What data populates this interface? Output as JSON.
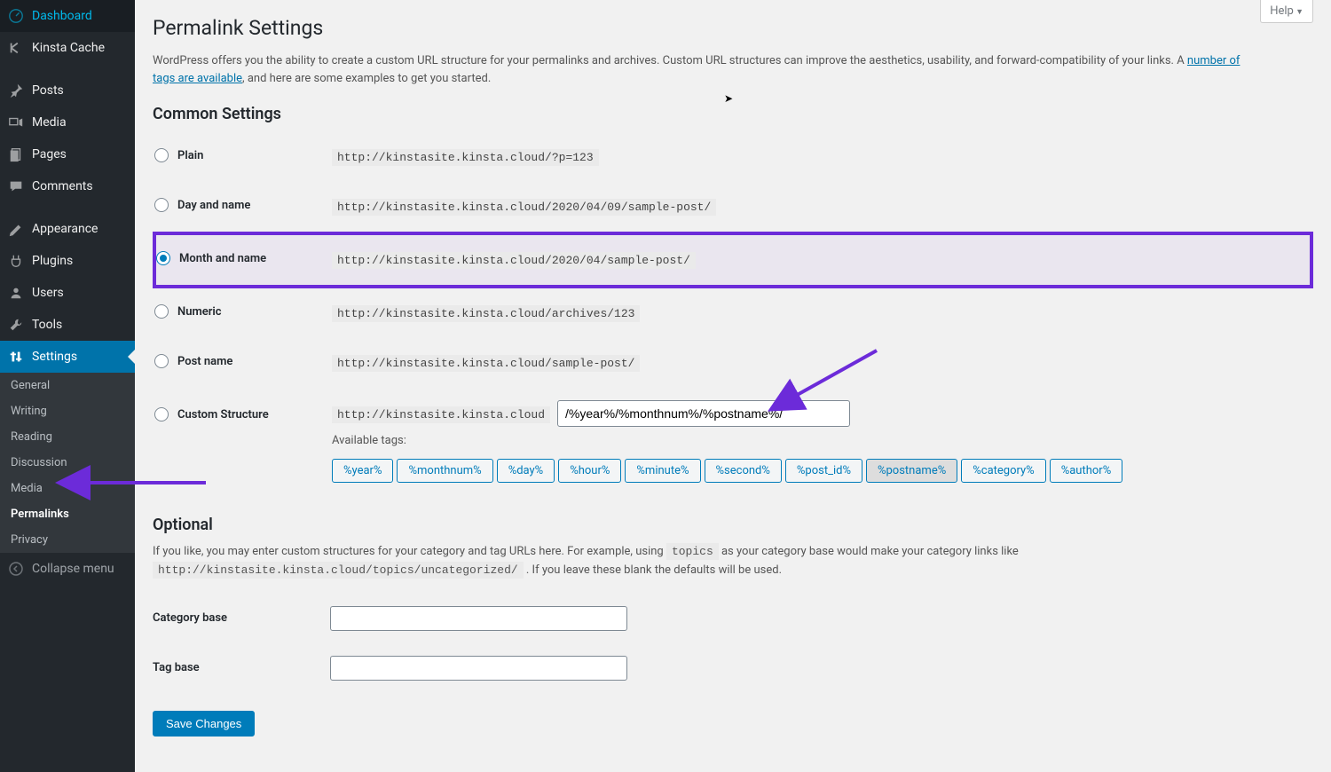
{
  "help": {
    "label": "Help"
  },
  "sidebar": {
    "items": [
      {
        "label": "Dashboard",
        "icon": "dashboard-icon"
      },
      {
        "label": "Kinsta Cache",
        "icon": "kinsta-icon"
      },
      {
        "sep": true
      },
      {
        "label": "Posts",
        "icon": "pin-icon"
      },
      {
        "label": "Media",
        "icon": "media-icon"
      },
      {
        "label": "Pages",
        "icon": "pages-icon"
      },
      {
        "label": "Comments",
        "icon": "comments-icon"
      },
      {
        "sep": true
      },
      {
        "label": "Appearance",
        "icon": "appearance-icon"
      },
      {
        "label": "Plugins",
        "icon": "plugins-icon"
      },
      {
        "label": "Users",
        "icon": "users-icon"
      },
      {
        "label": "Tools",
        "icon": "tools-icon"
      },
      {
        "label": "Settings",
        "icon": "settings-icon",
        "active": true
      }
    ],
    "submenu": [
      {
        "label": "General"
      },
      {
        "label": "Writing"
      },
      {
        "label": "Reading"
      },
      {
        "label": "Discussion"
      },
      {
        "label": "Media"
      },
      {
        "label": "Permalinks",
        "current": true
      },
      {
        "label": "Privacy"
      }
    ],
    "collapse": {
      "label": "Collapse menu"
    }
  },
  "page": {
    "title": "Permalink Settings",
    "intro_1": "WordPress offers you the ability to create a custom URL structure for your permalinks and archives. Custom URL structures can improve the aesthetics, usability, and forward-compatibility of your links. A ",
    "intro_link": "number of tags are available",
    "intro_2": ", and here are some examples to get you started.",
    "common_heading": "Common Settings",
    "options": [
      {
        "label": "Plain",
        "example": "http://kinstasite.kinsta.cloud/?p=123"
      },
      {
        "label": "Day and name",
        "example": "http://kinstasite.kinsta.cloud/2020/04/09/sample-post/"
      },
      {
        "label": "Month and name",
        "example": "http://kinstasite.kinsta.cloud/2020/04/sample-post/",
        "checked": true,
        "highlighted": true
      },
      {
        "label": "Numeric",
        "example": "http://kinstasite.kinsta.cloud/archives/123"
      },
      {
        "label": "Post name",
        "example": "http://kinstasite.kinsta.cloud/sample-post/"
      }
    ],
    "custom": {
      "label": "Custom Structure",
      "prefix": "http://kinstasite.kinsta.cloud",
      "value": "/%year%/%monthnum%/%postname%/",
      "available_label": "Available tags:",
      "tags": [
        "%year%",
        "%monthnum%",
        "%day%",
        "%hour%",
        "%minute%",
        "%second%",
        "%post_id%",
        "%postname%",
        "%category%",
        "%author%"
      ],
      "active_tags": [
        "%postname%"
      ]
    },
    "optional": {
      "heading": "Optional",
      "desc_1": "If you like, you may enter custom structures for your category and tag URLs here. For example, using ",
      "topics_code": "topics",
      "desc_2": " as your category base would make your category links like ",
      "example_code": "http://kinstasite.kinsta.cloud/topics/uncategorized/",
      "desc_3": " . If you leave these blank the defaults will be used.",
      "category_label": "Category base",
      "tag_label": "Tag base"
    },
    "save_label": "Save Changes"
  }
}
